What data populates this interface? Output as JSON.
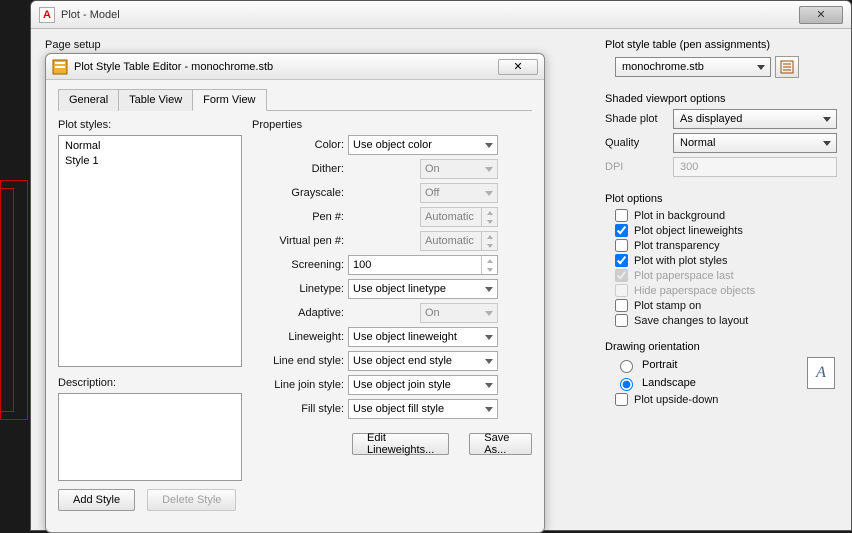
{
  "plot_dialog": {
    "title": "Plot - Model",
    "page_setup_label": "Page setup"
  },
  "editor": {
    "title": "Plot Style Table Editor - monochrome.stb",
    "tabs": {
      "general": "General",
      "table_view": "Table View",
      "form_view": "Form View"
    },
    "plot_styles_label": "Plot styles:",
    "plot_styles": {
      "s0": "Normal",
      "s1": "Style 1"
    },
    "description_label": "Description:",
    "description_value": "",
    "properties_label": "Properties",
    "props": {
      "color_label": "Color:",
      "color_value": "Use object color",
      "dither_label": "Dither:",
      "dither_value": "On",
      "grayscale_label": "Grayscale:",
      "grayscale_value": "Off",
      "pen_label": "Pen #:",
      "pen_value": "Automatic",
      "vpen_label": "Virtual pen #:",
      "vpen_value": "Automatic",
      "screening_label": "Screening:",
      "screening_value": "100",
      "linetype_label": "Linetype:",
      "linetype_value": "Use object linetype",
      "adaptive_label": "Adaptive:",
      "adaptive_value": "On",
      "lineweight_label": "Lineweight:",
      "lineweight_value": "Use object lineweight",
      "endstyle_label": "Line end style:",
      "endstyle_value": "Use object end style",
      "joinstyle_label": "Line join style:",
      "joinstyle_value": "Use object join style",
      "fillstyle_label": "Fill style:",
      "fillstyle_value": "Use object fill style"
    },
    "buttons": {
      "edit_lineweights": "Edit Lineweights...",
      "save_as": "Save As...",
      "add_style": "Add Style",
      "delete_style": "Delete Style"
    }
  },
  "right": {
    "plot_style_table": {
      "title": "Plot style table (pen assignments)",
      "value": "monochrome.stb"
    },
    "shaded": {
      "title": "Shaded viewport options",
      "shade_label": "Shade plot",
      "shade_value": "As displayed",
      "quality_label": "Quality",
      "quality_value": "Normal",
      "dpi_label": "DPI",
      "dpi_value": "300"
    },
    "options": {
      "title": "Plot options",
      "bg": "Plot in background",
      "lw": "Plot object lineweights",
      "tr": "Plot transparency",
      "ps": "Plot with plot styles",
      "pl": "Plot paperspace last",
      "hp": "Hide paperspace objects",
      "st": "Plot stamp on",
      "sv": "Save changes to layout"
    },
    "orient": {
      "title": "Drawing orientation",
      "portrait": "Portrait",
      "landscape": "Landscape",
      "upside": "Plot upside-down",
      "glyph": "A"
    }
  }
}
